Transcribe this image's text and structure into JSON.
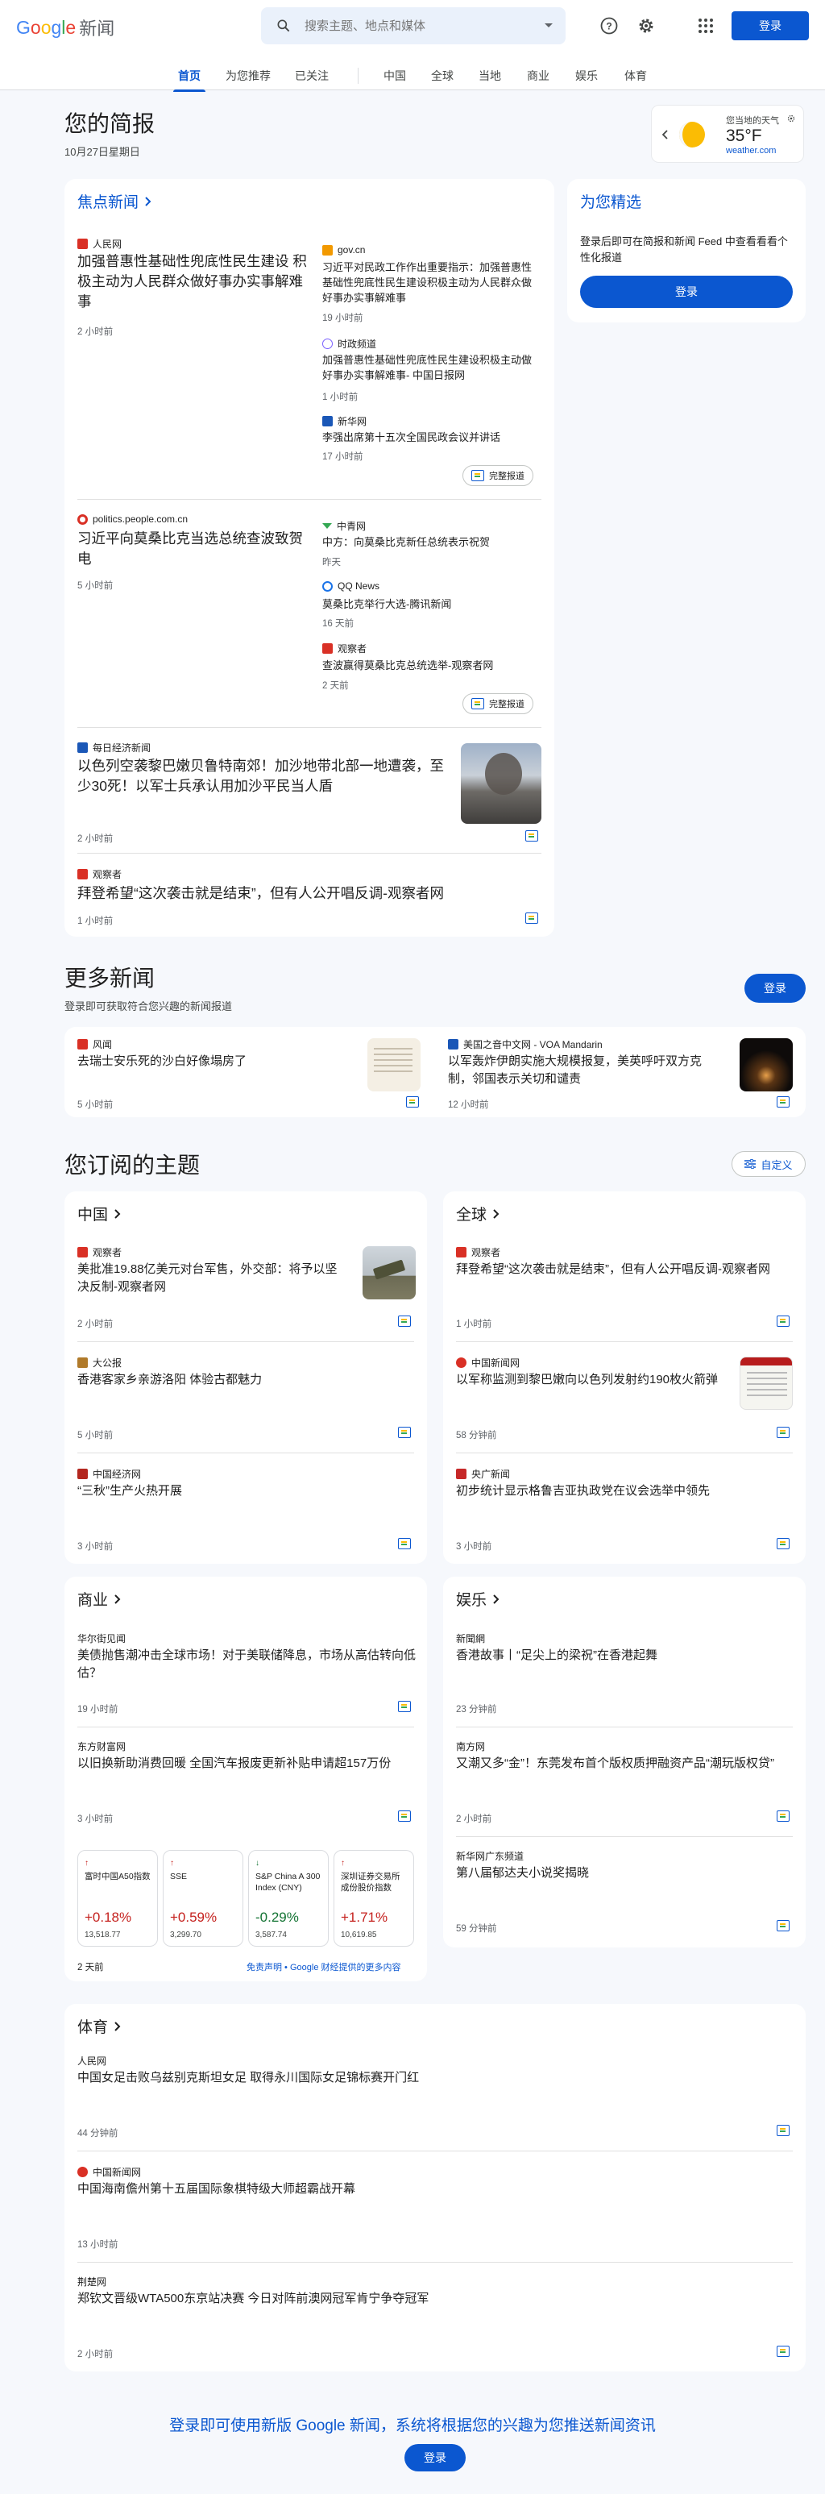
{
  "header": {
    "logo_text": "Google",
    "logo_suffix": "新闻",
    "search_placeholder": "搜索主题、地点和媒体",
    "signin": "登录"
  },
  "nav": {
    "tabs": [
      "首页",
      "为您推荐",
      "已关注",
      "中国",
      "全球",
      "当地",
      "商业",
      "娱乐",
      "体育"
    ]
  },
  "briefing": {
    "title": "您的简报",
    "date": "10月27日星期日"
  },
  "weather": {
    "label": "您当地的天气",
    "temp": "35°F",
    "source": "weather.com"
  },
  "picks": {
    "title": "为您精选",
    "desc": "登录后即可在简报和新闻 Feed 中查看看看个性化报道",
    "button": "登录"
  },
  "top": {
    "title": "焦点新闻",
    "full_coverage": "完整报道",
    "c1": {
      "source": "人民网",
      "headline": "加强普惠性基础性兜底性民生建设 积极主动为人民群众做好事办实事解难事",
      "time": "2 小时前",
      "side": [
        {
          "source": "gov.cn",
          "headline": "习近平对民政工作作出重要指示：加强普惠性基础性兜底性民生建设积极主动为人民群众做好事办实事解难事",
          "time": "19 小时前"
        },
        {
          "source": "时政频道",
          "headline": "加强普惠性基础性兜底性民生建设积极主动做好事办实事解难事- 中国日报网",
          "time": "1 小时前"
        },
        {
          "source": "新华网",
          "headline": "李强出席第十五次全国民政会议并讲话",
          "time": "17 小时前"
        }
      ]
    },
    "c2": {
      "source": "politics.people.com.cn",
      "headline": "习近平向莫桑比克当选总统查波致贺电",
      "time": "5 小时前",
      "side": [
        {
          "source": "中青网",
          "headline": "中方：向莫桑比克新任总统表示祝贺",
          "time": "昨天"
        },
        {
          "source": "QQ News",
          "headline": "莫桑比克举行大选-腾讯新闻",
          "time": "16 天前"
        },
        {
          "source": "观察者",
          "headline": "查波赢得莫桑比克总统选举-观察者网",
          "time": "2 天前"
        }
      ]
    },
    "c3": {
      "source": "每日经济新闻",
      "headline": "以色列空袭黎巴嫩贝鲁特南郊！加沙地带北部一地遭袭，至少30死！以军士兵承认用加沙平民当人盾",
      "time": "2 小时前"
    },
    "c4": {
      "source": "观察者",
      "headline": "拜登希望“这次袭击就是结束”，但有人公开唱反调-观察者网",
      "time": "1 小时前"
    }
  },
  "more": {
    "title": "更多新闻",
    "desc": "登录即可获取符合您兴趣的新闻报道",
    "button": "登录",
    "items": [
      {
        "source": "风闻",
        "headline": "去瑞士安乐死的沙白好像塌房了",
        "time": "5 小时前"
      },
      {
        "source": "美国之音中文网 - VOA Mandarin",
        "headline": "以军轰炸伊朗实施大规模报复，美英呼吁双方克制，邻国表示关切和谴责",
        "time": "12 小时前"
      }
    ]
  },
  "topics": {
    "title": "您订阅的主题",
    "customize": "自定义",
    "china": {
      "title": "中国",
      "items": [
        {
          "source": "观察者",
          "headline": "美批准19.88亿美元对台军售，外交部：将予以坚决反制-观察者网",
          "time": "2 小时前"
        },
        {
          "source": "大公报",
          "headline": "香港客家乡亲游洛阳 体验古都魅力",
          "time": "5 小时前"
        },
        {
          "source": "中国经济网",
          "headline": "“三秋”生产火热开展",
          "time": "3 小时前"
        }
      ]
    },
    "world": {
      "title": "全球",
      "items": [
        {
          "source": "观察者",
          "headline": "拜登希望“这次袭击就是结束”，但有人公开唱反调-观察者网",
          "time": "1 小时前"
        },
        {
          "source": "中国新闻网",
          "headline": "以军称监测到黎巴嫩向以色列发射约190枚火箭弹",
          "time": "58 分钟前"
        },
        {
          "source": "央广新闻",
          "headline": "初步统计显示格鲁吉亚执政党在议会选举中领先",
          "time": "3 小时前"
        }
      ]
    },
    "business": {
      "title": "商业",
      "items": [
        {
          "source": "华尔街见闻",
          "headline": "美债抛售潮冲击全球市场！对于美联储降息，市场从高估转向低估？",
          "time": "19 小时前"
        },
        {
          "source": "东方财富网",
          "headline": "以旧换新助消费回暖 全国汽车报废更新补贴申请超157万份",
          "time": "3 小时前"
        }
      ],
      "stocks": [
        {
          "name": "富时中国A50指数",
          "change": "+0.18%",
          "value": "13,518.77",
          "dir": "up"
        },
        {
          "name": "SSE",
          "change": "+0.59%",
          "value": "3,299.70",
          "dir": "up"
        },
        {
          "name": "S&P China A 300 Index (CNY)",
          "change": "-0.29%",
          "value": "3,587.74",
          "dir": "down"
        },
        {
          "name": "深圳证券交易所成份股价指数",
          "change": "+1.71%",
          "value": "10,619.85",
          "dir": "up"
        }
      ],
      "stocks_time": "2 天前",
      "disclaimer": "免责声明 • Google 财经提供的更多内容"
    },
    "entertainment": {
      "title": "娱乐",
      "items": [
        {
          "source": "新聞網",
          "headline": "香港故事丨“足尖上的梁祝”在香港起舞",
          "time": "23 分钟前"
        },
        {
          "source": "南方网",
          "headline": "又潮又多“金”！东莞发布首个版权质押融资产品“潮玩版权贷”",
          "time": "2 小时前"
        },
        {
          "source": "新华网广东频道",
          "headline": "第八届郁达夫小说奖揭晓",
          "time": "59 分钟前"
        }
      ]
    },
    "sports": {
      "title": "体育",
      "items": [
        {
          "source": "人民网",
          "headline": "中国女足击败乌兹别克斯坦女足 取得永川国际女足锦标赛开门红",
          "time": "44 分钟前"
        },
        {
          "source": "中国新闻网",
          "headline": "中国海南儋州第十五届国际象棋特级大师超霸战开幕",
          "time": "13 小时前"
        },
        {
          "source": "荆楚网",
          "headline": "郑钦文晋级WTA500东京站决赛 今日对阵前澳网冠军肯宁争夺冠军",
          "time": "2 小时前"
        }
      ]
    }
  },
  "footer": {
    "text": "登录即可使用新版 Google 新闻，系统将根据您的兴趣为您推送新闻资讯",
    "button": "登录"
  }
}
